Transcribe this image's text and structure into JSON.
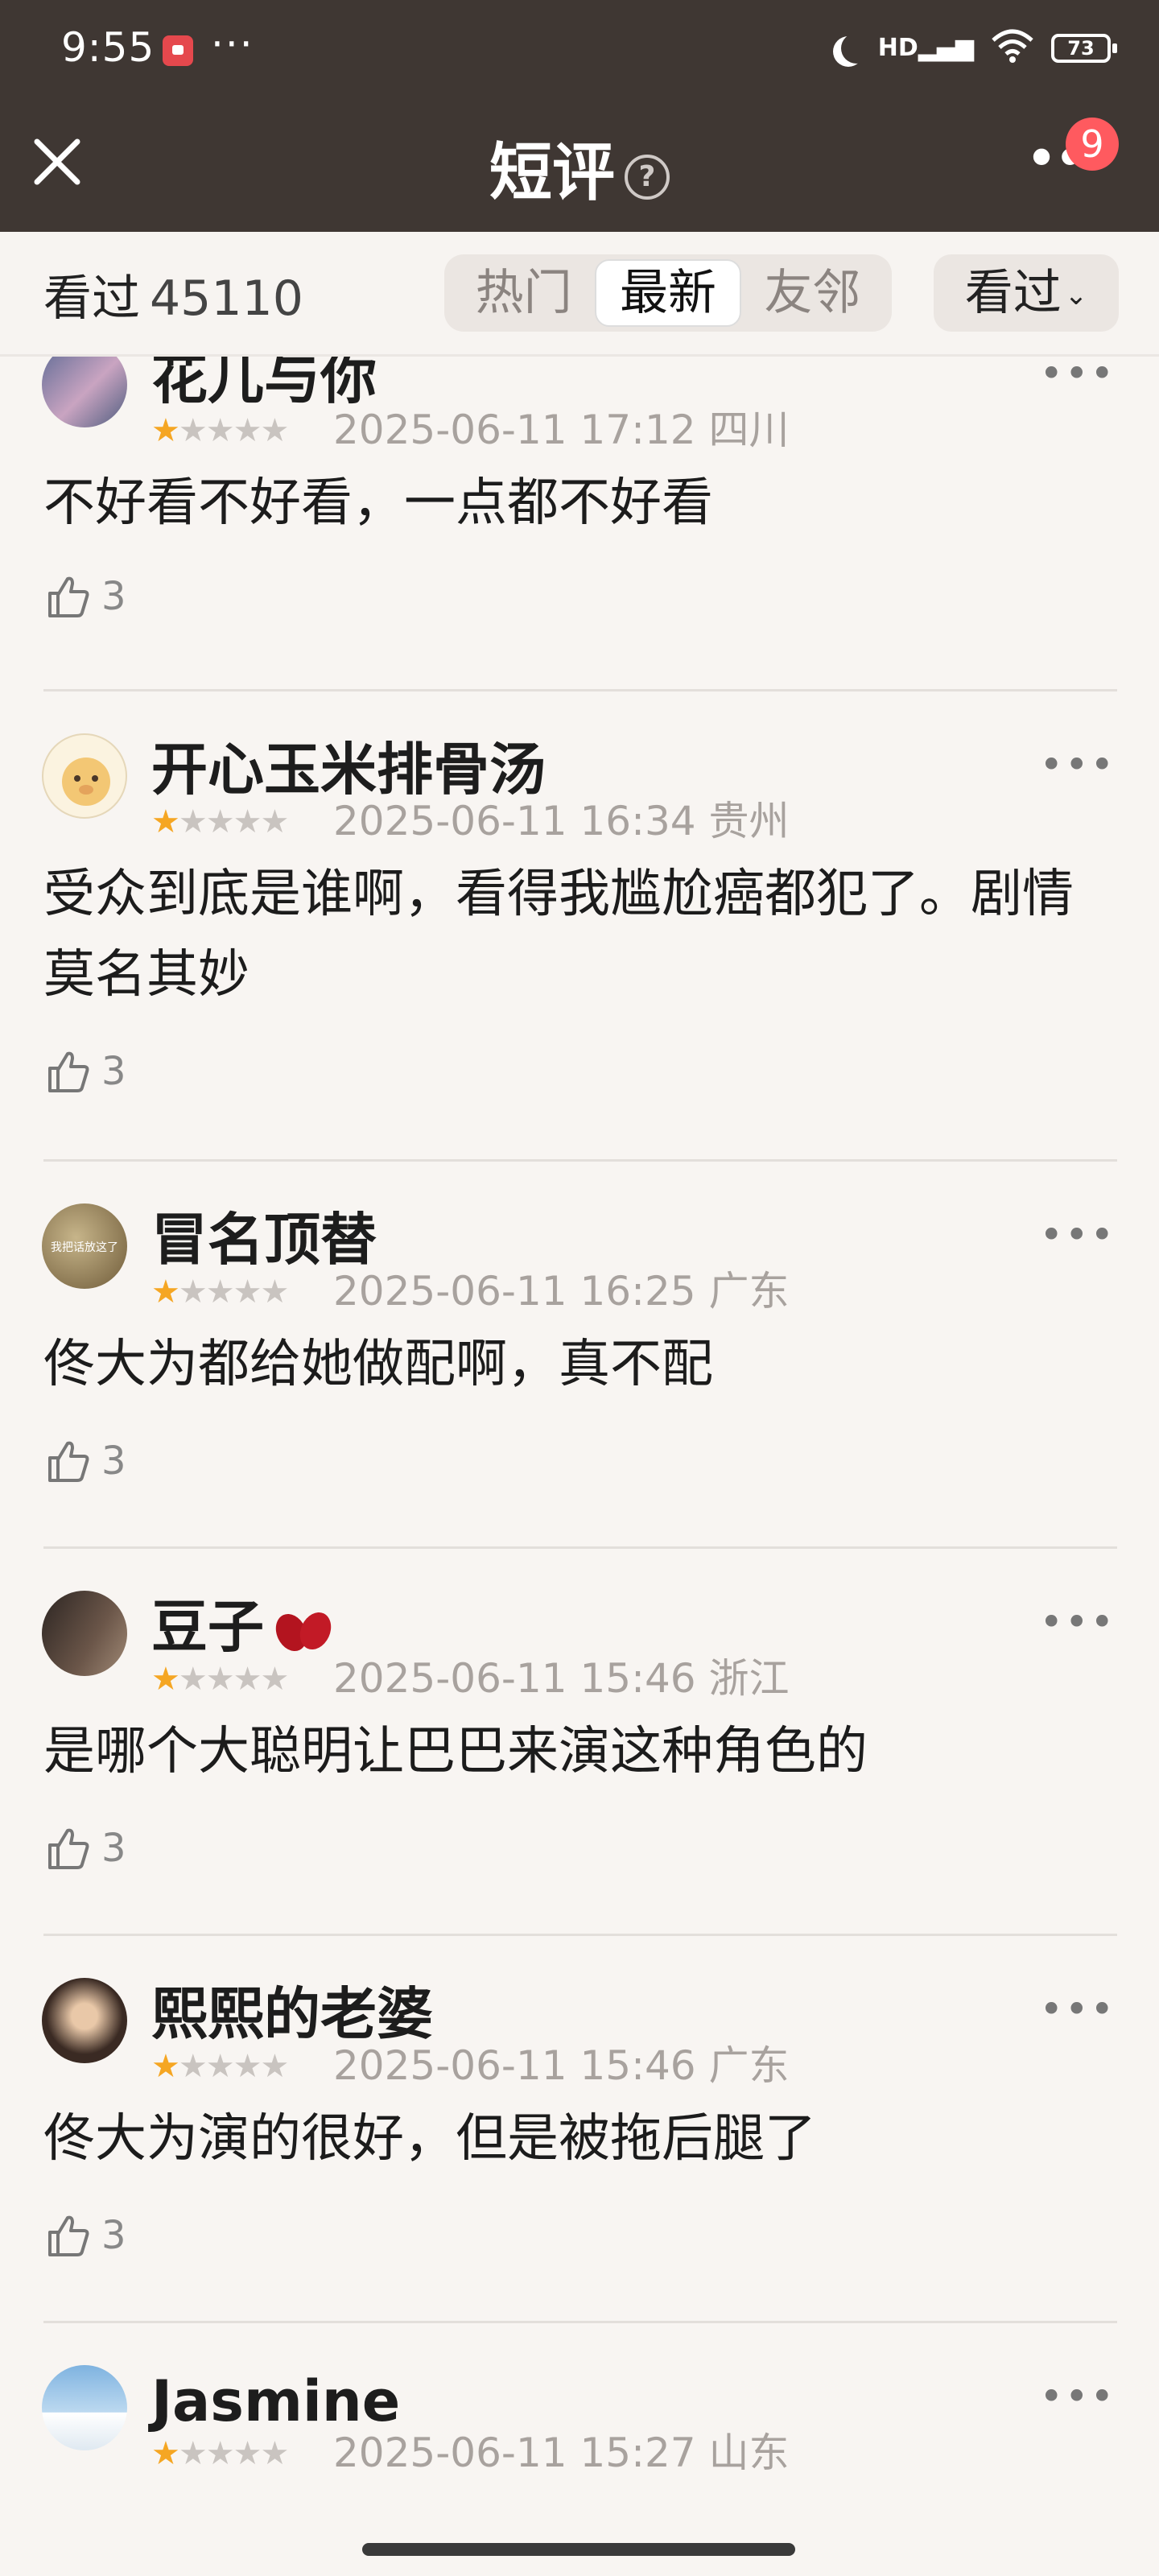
{
  "status": {
    "time": "9:55",
    "dots": "···",
    "hd": "HD",
    "battery": "73"
  },
  "header": {
    "title": "短评",
    "help": "?",
    "notification_count": "9"
  },
  "filter": {
    "seen_label": "看过",
    "seen_count": "45110",
    "tabs": [
      {
        "label": "热门"
      },
      {
        "label": "最新"
      },
      {
        "label": "友邻"
      }
    ],
    "active_tab": "最新",
    "seen_select": "看过"
  },
  "reviews": [
    {
      "user": "花儿与你",
      "time": "2025-06-11 17:12 四川",
      "rating": 1,
      "content": "不好看不好看，一点都不好看",
      "likes": "3"
    },
    {
      "user": "开心玉米排骨汤",
      "time": "2025-06-11 16:34 贵州",
      "rating": 1,
      "content": "受众到底是谁啊，看得我尴尬癌都犯了。剧情莫名其妙",
      "likes": "3"
    },
    {
      "user": "冒名顶替",
      "time": "2025-06-11 16:25 广东",
      "rating": 1,
      "content": "佟大为都给她做配啊，真不配",
      "likes": "3",
      "avatar_text": "我把话放这了"
    },
    {
      "user": "豆子",
      "time": "2025-06-11 15:46 浙江",
      "rating": 1,
      "content": "是哪个大聪明让巴巴来演这种角色的",
      "likes": "3"
    },
    {
      "user": "熙熙的老婆",
      "time": "2025-06-11 15:46 广东",
      "rating": 1,
      "content": "佟大为演的很好，但是被拖后腿了",
      "likes": "3"
    },
    {
      "user": "Jasmine",
      "time": "2025-06-11 15:27 山东",
      "rating": 1,
      "content": "",
      "likes": ""
    }
  ],
  "colors": {
    "header_bg": "#3f3733",
    "star_on": "#f5a623",
    "badge": "#ff5a5f"
  }
}
